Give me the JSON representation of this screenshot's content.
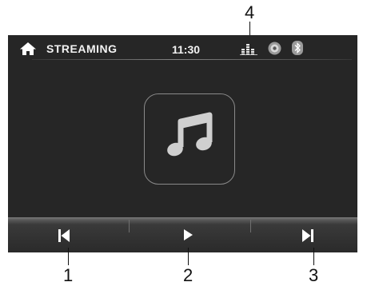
{
  "status_bar": {
    "source": "STREAMING",
    "time": "11:30"
  },
  "callouts": [
    "1",
    "2",
    "3",
    "4"
  ],
  "icons": {
    "home": "home-icon",
    "equalizer": "equalizer-icon",
    "disc": "disc-icon",
    "bluetooth": "bluetooth-icon",
    "music_note": "music-note-icon",
    "previous": "skip-previous-icon",
    "play": "play-icon",
    "next": "skip-next-icon"
  },
  "colors": {
    "screen_background": "#262626",
    "text": "#f2f2f2",
    "album_border": "#8a8a8a"
  }
}
